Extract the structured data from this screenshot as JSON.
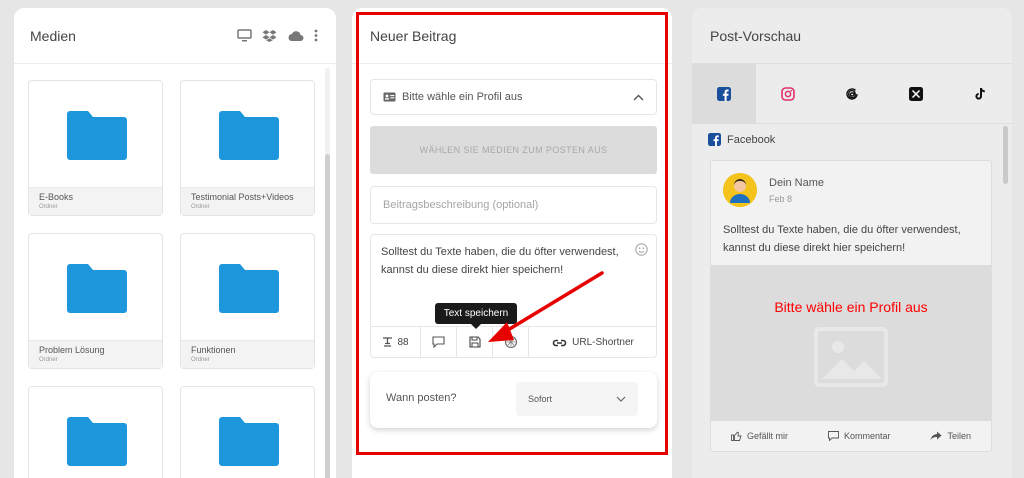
{
  "media": {
    "title": "Medien",
    "folders": [
      {
        "name": "E-Books",
        "type": "Ordner"
      },
      {
        "name": "Testimonial Posts+Videos",
        "type": "Ordner"
      },
      {
        "name": "Problem Lösung",
        "type": "Ordner"
      },
      {
        "name": "Funktionen",
        "type": "Ordner"
      }
    ],
    "folder_color": "#1e96dc"
  },
  "compose": {
    "title": "Neuer Beitrag",
    "profile_placeholder": "Bitte wähle ein Profil aus",
    "media_button": "WÄHLEN SIE MEDIEN ZUM POSTEN AUS",
    "description_placeholder": "Beitragsbeschreibung (optional)",
    "editor_text": "Solltest du Texte haben, die du öfter verwendest, kannst du diese direkt hier speichern!",
    "char_count": "88",
    "tooltip": "Text speichern",
    "url_shortener": "URL-Shortner",
    "when_label": "Wann posten?",
    "when_value": "Sofort",
    "highlight_color": "#e60000"
  },
  "preview": {
    "title": "Post-Vorschau",
    "network_label": "Facebook",
    "author": "Dein Name",
    "date": "Feb 8",
    "text": "Solltest du Texte haben, die du öfter verwendest, kannst du diese direkt hier speichern!",
    "warning": "Bitte wähle ein Profil aus",
    "actions": {
      "like": "Gefällt mir",
      "comment": "Kommentar",
      "share": "Teilen"
    },
    "tabs": [
      "facebook-icon",
      "instagram-icon",
      "threads-icon",
      "x-icon",
      "tiktok-icon"
    ],
    "warning_color": "#ff0000"
  }
}
